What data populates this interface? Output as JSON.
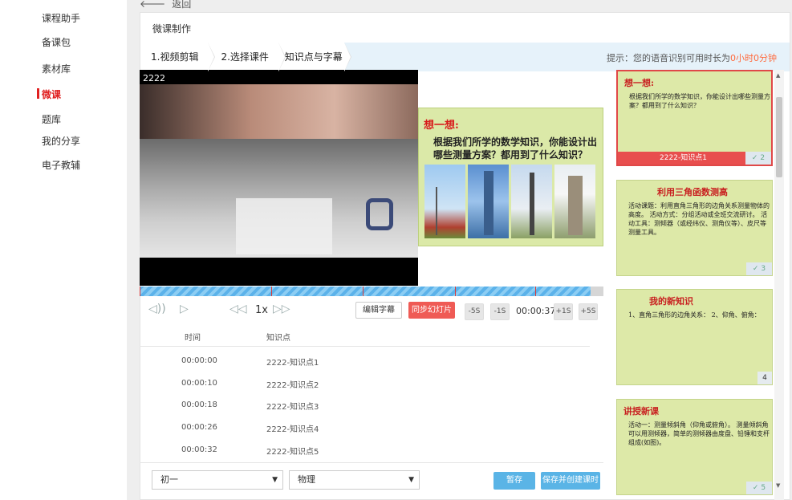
{
  "sidebar": {
    "items": [
      {
        "label": "课程助手"
      },
      {
        "label": "备课包"
      },
      {
        "label": "素材库"
      },
      {
        "label": "微课"
      },
      {
        "label": "题库"
      },
      {
        "label": "我的分享"
      },
      {
        "label": "电子教辅"
      }
    ],
    "active_index": 3
  },
  "back": {
    "label": "返回"
  },
  "panel": {
    "title": "微课制作"
  },
  "steps": [
    {
      "label": "1.视频剪辑"
    },
    {
      "label": "2.选择课件"
    },
    {
      "label": ".知识点与字幕"
    }
  ],
  "hint": {
    "prefix": "提示：您的语音识别可用时长为",
    "value": "0小时0分钟"
  },
  "video": {
    "label": "2222"
  },
  "slide": {
    "title": "想一想:",
    "text": "根据我们所学的数学知识，你能设计出哪些测量方案？都用到了什么知识？"
  },
  "controls": {
    "speed": "1x",
    "edit_label": "编辑字幕",
    "sync_label": "同步幻灯片",
    "minus5": "-5S",
    "minus1": "-1S",
    "current_time": "00:00:37",
    "plus1": "+1S",
    "plus5": "+5S"
  },
  "table": {
    "headers": {
      "time": "时间",
      "kp": "知识点"
    },
    "rows": [
      {
        "time": "00:00:00",
        "kp": "2222-知识点1"
      },
      {
        "time": "00:00:10",
        "kp": "2222-知识点2"
      },
      {
        "time": "00:00:18",
        "kp": "2222-知识点3"
      },
      {
        "time": "00:00:26",
        "kp": "2222-知识点4"
      },
      {
        "time": "00:00:32",
        "kp": "2222-知识点5"
      }
    ]
  },
  "bottom": {
    "grade_select": "初一",
    "subject_select": "物理",
    "pause_label": "暂存",
    "save_label": "保存并创建课时"
  },
  "thumbs": [
    {
      "title": "想一想:",
      "body": "根据我们所学的数学知识，你能设计出哪些测量方案？都用到了什么知识？",
      "caption": "2222-知识点1",
      "num": "2"
    },
    {
      "title": "利用三角函数测高",
      "body": "活动课题：利用直角三角形的边角关系测量物体的高度。 活动方式：分组活动或全班交流研讨。 活动工具：测倾器（或经纬仪、测角仪等）、皮尺等测量工具。",
      "caption": "",
      "num": "3"
    },
    {
      "title": "我的新知识",
      "body": "1、直角三角形的边角关系： 2、仰角、俯角：",
      "caption": "",
      "num": "4"
    },
    {
      "title": "讲授新课",
      "body": "活动一：测量倾斜角（仰角或俯角）。 测量倾斜角可以用测倾器，简单的测倾器由度盘、铅锤和支杆组成(如图)。",
      "caption": "",
      "num": "5"
    }
  ]
}
